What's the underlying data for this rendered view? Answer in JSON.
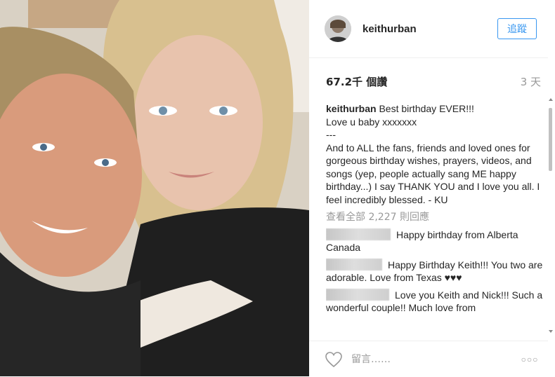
{
  "post": {
    "username": "keithurban",
    "follow_label": "追蹤",
    "views": "67.2千 個讚",
    "time_ago": "3 天"
  },
  "caption": {
    "username": "keithurban",
    "text": "Best birthday EVER!!!\nLove u baby xxxxxxx\n---\nAnd to ALL the fans, friends and loved ones for gorgeous birthday wishes, prayers, videos, and songs (yep, people actually sang ME happy birthday...) I say THANK YOU and I love you all. I feel incredibly blessed. - KU"
  },
  "view_all_comments": "查看全部 2,227 則回應",
  "comments": [
    {
      "text": "Happy birthday from Alberta Canada"
    },
    {
      "text": "Happy Birthday Keith!!! You two are adorable. Love from Texas ♥♥♥"
    },
    {
      "text": "Love you Keith and Nick!!! Such a wonderful couple!! Much love from"
    }
  ],
  "footer": {
    "comment_placeholder": "留言……",
    "more_label": "○○○"
  },
  "icons": {
    "like": "heart-icon",
    "more": "more-options-icon",
    "avatar": "avatar"
  },
  "colors": {
    "accent": "#3897f0",
    "muted": "#999999",
    "text": "#262626"
  }
}
